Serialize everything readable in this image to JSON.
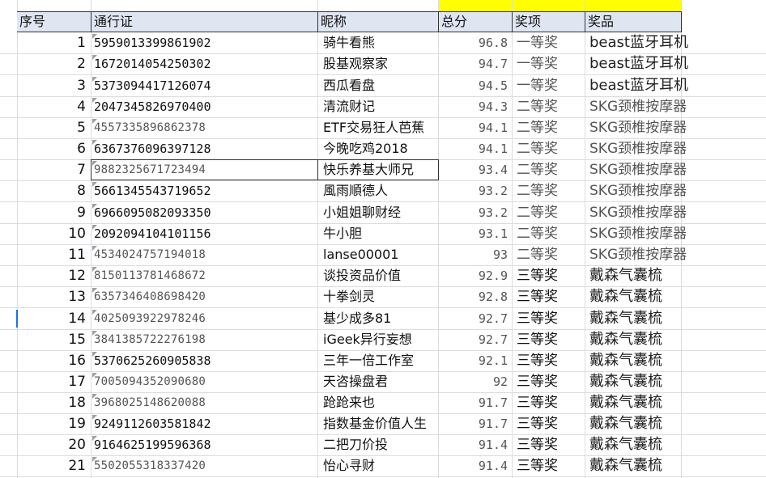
{
  "sheet": {
    "headers": {
      "seq": "序号",
      "pass_id": "通行证",
      "nickname": "昵称",
      "score": "总分",
      "award": "奖项",
      "prize": "奖品"
    },
    "colors": {
      "highlight": "#ffff00",
      "header_bg": "#dfe6f2",
      "grid": "#dadce0",
      "selection": "#1a73e8",
      "comment_marker": "#9aa0a6"
    },
    "rows": [
      {
        "seq": "1",
        "pass_id": "5959013399861902",
        "nickname": "骑牛看熊",
        "score": "96.8",
        "award": "一等奖",
        "prize": "beast蓝牙耳机"
      },
      {
        "seq": "2",
        "pass_id": "1672014054250302",
        "nickname": "股基观察家",
        "score": "94.7",
        "award": "一等奖",
        "prize": "beast蓝牙耳机"
      },
      {
        "seq": "3",
        "pass_id": "5373094417126074",
        "nickname": "西瓜看盘",
        "score": "94.5",
        "award": "一等奖",
        "prize": "beast蓝牙耳机"
      },
      {
        "seq": "4",
        "pass_id": "2047345826970400",
        "nickname": "清流财记",
        "score": "94.3",
        "award": "二等奖",
        "prize": "SKG颈椎按摩器"
      },
      {
        "seq": "5",
        "pass_id": "4557335896862378",
        "nickname": "ETF交易狂人芭蕉",
        "score": "94.1",
        "award": "二等奖",
        "prize": "SKG颈椎按摩器"
      },
      {
        "seq": "6",
        "pass_id": "6367376096397128",
        "nickname": "今晚吃鸡2018",
        "score": "94.1",
        "award": "二等奖",
        "prize": "SKG颈椎按摩器"
      },
      {
        "seq": "7",
        "pass_id": "9882325671723494",
        "nickname": "快乐养基大师兄",
        "score": "93.4",
        "award": "二等奖",
        "prize": "SKG颈椎按摩器"
      },
      {
        "seq": "8",
        "pass_id": "5661345543719652",
        "nickname": "風雨順德人",
        "score": "93.2",
        "award": "二等奖",
        "prize": "SKG颈椎按摩器"
      },
      {
        "seq": "9",
        "pass_id": "6966095082093350",
        "nickname": "小姐姐聊财经",
        "score": "93.2",
        "award": "二等奖",
        "prize": "SKG颈椎按摩器"
      },
      {
        "seq": "10",
        "pass_id": "2092094104101156",
        "nickname": "牛小胆",
        "score": "93.1",
        "award": "二等奖",
        "prize": "SKG颈椎按摩器"
      },
      {
        "seq": "11",
        "pass_id": "4534024757194018",
        "nickname": "lanse00001",
        "score": "93",
        "award": "二等奖",
        "prize": "SKG颈椎按摩器"
      },
      {
        "seq": "12",
        "pass_id": "8150113781468672",
        "nickname": "谈投资品价值",
        "score": "92.9",
        "award": "三等奖",
        "prize": "戴森气囊梳"
      },
      {
        "seq": "13",
        "pass_id": "6357346408698420",
        "nickname": "十拳剑灵",
        "score": "92.8",
        "award": "三等奖",
        "prize": "戴森气囊梳"
      },
      {
        "seq": "14",
        "pass_id": "4025093922978246",
        "nickname": "基少成多81",
        "score": "92.7",
        "award": "三等奖",
        "prize": "戴森气囊梳"
      },
      {
        "seq": "15",
        "pass_id": "3841385722276198",
        "nickname": "iGeek异行妄想",
        "score": "92.7",
        "award": "三等奖",
        "prize": "戴森气囊梳"
      },
      {
        "seq": "16",
        "pass_id": "5370625260905838",
        "nickname": "三年一倍工作室",
        "score": "92.1",
        "award": "三等奖",
        "prize": "戴森气囊梳"
      },
      {
        "seq": "17",
        "pass_id": "7005094352090680",
        "nickname": "天咨操盘君",
        "score": "92",
        "award": "三等奖",
        "prize": "戴森气囊梳"
      },
      {
        "seq": "18",
        "pass_id": "3968025148620088",
        "nickname": "跄跄来也",
        "score": "91.7",
        "award": "三等奖",
        "prize": "戴森气囊梳"
      },
      {
        "seq": "19",
        "pass_id": "9249112603581842",
        "nickname": "指数基金价值人生",
        "score": "91.7",
        "award": "三等奖",
        "prize": "戴森气囊梳"
      },
      {
        "seq": "20",
        "pass_id": "9164625199596368",
        "nickname": "二把刀价投",
        "score": "91.4",
        "award": "三等奖",
        "prize": "戴森气囊梳"
      },
      {
        "seq": "21",
        "pass_id": "5502055318337420",
        "nickname": "怡心寻财",
        "score": "91.4",
        "award": "三等奖",
        "prize": "戴森气囊梳"
      }
    ]
  }
}
